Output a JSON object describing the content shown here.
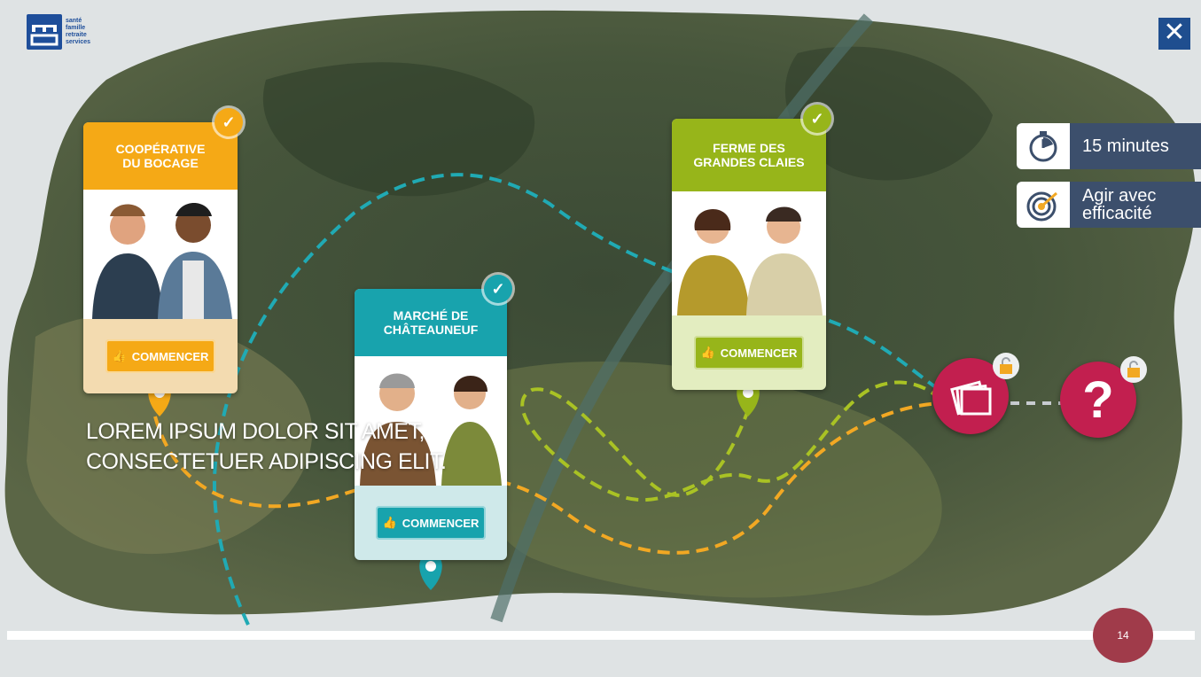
{
  "logo": {
    "lines": [
      "santé",
      "famille",
      "retraite",
      "services"
    ],
    "mark": "msa-logo"
  },
  "close": {
    "symbol": "✕",
    "icon": "close-icon"
  },
  "info": {
    "duration": "15 minutes",
    "goal_line1": "Agir avec",
    "goal_line2": "efficacité"
  },
  "cards": [
    {
      "title_1": "COOPÉRATIVE",
      "title_2": "DU BOCAGE",
      "button": "COMMENCER",
      "color": "#f5a916",
      "completed": true
    },
    {
      "title_1": "MARCHÉ DE",
      "title_2": "CHÂTEAUNEUF",
      "button": "COMMENCER",
      "color": "#18a3ad",
      "completed": true
    },
    {
      "title_1": "FERME DES",
      "title_2": "GRANDES CLAIES",
      "button": "COMMENCER",
      "color": "#97b51a",
      "completed": true
    }
  ],
  "locked": [
    {
      "icon": "cards-stack-icon",
      "locked": true
    },
    {
      "icon": "question-icon",
      "locked": true
    }
  ],
  "overlay_text": {
    "line1": "LOREM IPSUM DOLOR SIT AMET,",
    "line2": "CONSECTETUER ADIPISCING ELIT."
  },
  "page_number": "14",
  "colors": {
    "accent_blue": "#1f4e8f",
    "chip": "#3c4f6c",
    "locked": "#c21f4f",
    "badge": "#a03b4a"
  }
}
